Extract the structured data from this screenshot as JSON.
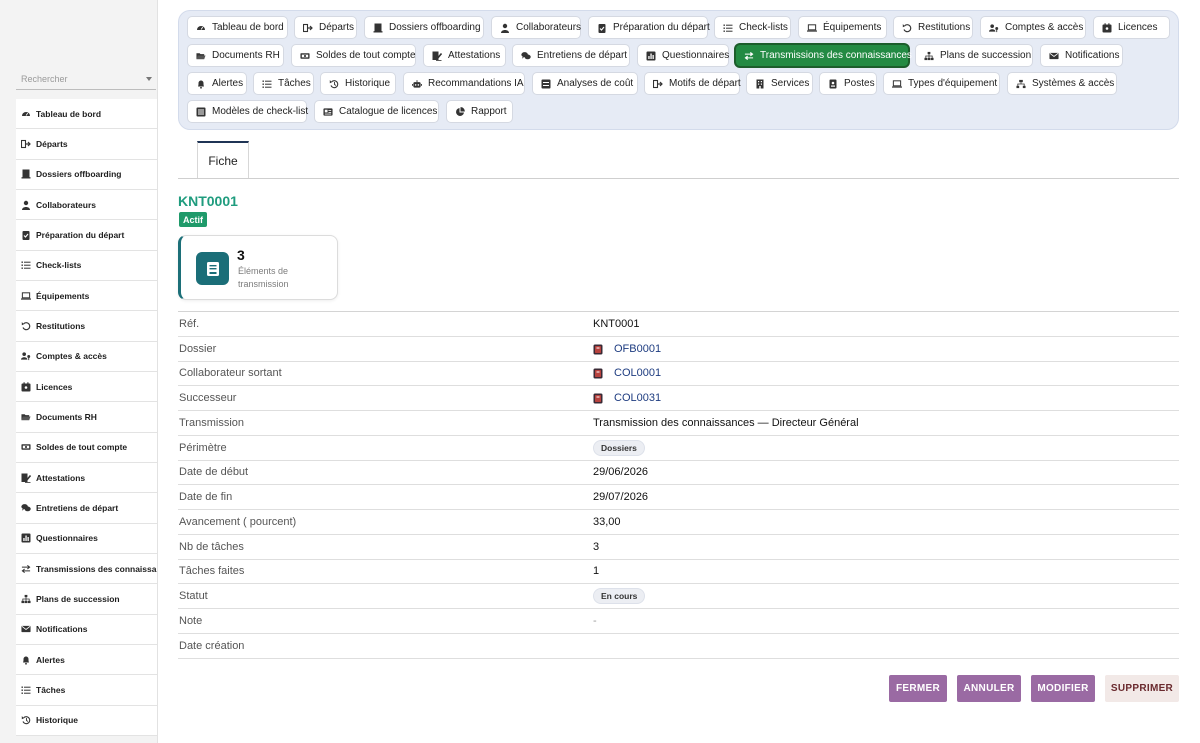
{
  "search": {
    "placeholder": "Rechercher"
  },
  "sidebar": {
    "items": [
      {
        "label": "Tableau de bord",
        "icon": "dashboard-icon"
      },
      {
        "label": "Départs",
        "icon": "exit-icon"
      },
      {
        "label": "Dossiers offboarding",
        "icon": "folder-user-icon"
      },
      {
        "label": "Collaborateurs",
        "icon": "user-icon"
      },
      {
        "label": "Préparation du départ",
        "icon": "clipboard-check-icon"
      },
      {
        "label": "Check-lists",
        "icon": "list-icon"
      },
      {
        "label": "Équipements",
        "icon": "laptop-icon"
      },
      {
        "label": "Restitutions",
        "icon": "undo-icon"
      },
      {
        "label": "Comptes & accès",
        "icon": "users-key-icon"
      },
      {
        "label": "Licences",
        "icon": "license-icon"
      },
      {
        "label": "Documents RH",
        "icon": "folder-open-icon"
      },
      {
        "label": "Soldes de tout compte",
        "icon": "money-icon"
      },
      {
        "label": "Attestations",
        "icon": "signature-icon"
      },
      {
        "label": "Entretiens de départ",
        "icon": "comments-icon"
      },
      {
        "label": "Questionnaires",
        "icon": "poll-icon"
      },
      {
        "label": "Transmissions des connaissances",
        "icon": "exchange-icon"
      },
      {
        "label": "Plans de succession",
        "icon": "sitemap-icon"
      },
      {
        "label": "Notifications",
        "icon": "envelope-icon"
      },
      {
        "label": "Alertes",
        "icon": "bell-icon"
      },
      {
        "label": "Tâches",
        "icon": "tasks-icon"
      },
      {
        "label": "Historique",
        "icon": "history-icon"
      }
    ]
  },
  "toolbar": {
    "buttons": [
      {
        "label": "Tableau de bord",
        "icon": "dashboard-icon"
      },
      {
        "label": "Départs",
        "icon": "exit-icon"
      },
      {
        "label": "Dossiers offboarding",
        "icon": "folder-user-icon"
      },
      {
        "label": "Collaborateurs",
        "icon": "user-icon"
      },
      {
        "label": "Préparation du départ",
        "icon": "clipboard-check-icon"
      },
      {
        "label": "Check-lists",
        "icon": "list-icon"
      },
      {
        "label": "Équipements",
        "icon": "laptop-icon"
      },
      {
        "label": "Restitutions",
        "icon": "undo-icon"
      },
      {
        "label": "Comptes & accès",
        "icon": "users-key-icon"
      },
      {
        "label": "Licences",
        "icon": "license-icon"
      },
      {
        "label": "Documents RH",
        "icon": "folder-open-icon"
      },
      {
        "label": "Soldes de tout compte",
        "icon": "money-icon"
      },
      {
        "label": "Attestations",
        "icon": "signature-icon"
      },
      {
        "label": "Entretiens de départ",
        "icon": "comments-icon"
      },
      {
        "label": "Questionnaires",
        "icon": "poll-icon"
      },
      {
        "label": "Transmissions des connaissances",
        "icon": "exchange-icon",
        "active": true
      },
      {
        "label": "Plans de succession",
        "icon": "sitemap-icon"
      },
      {
        "label": "Notifications",
        "icon": "envelope-icon"
      },
      {
        "label": "Alertes",
        "icon": "bell-icon"
      },
      {
        "label": "Tâches",
        "icon": "tasks-icon"
      },
      {
        "label": "Historique",
        "icon": "history-icon"
      },
      {
        "label": "Recommandations IA",
        "icon": "robot-icon"
      },
      {
        "label": "Analyses de coût",
        "icon": "money-bill-icon"
      },
      {
        "label": "Motifs de départ",
        "icon": "exit-icon"
      },
      {
        "label": "Services",
        "icon": "building-icon"
      },
      {
        "label": "Postes",
        "icon": "id-badge-icon"
      },
      {
        "label": "Types d'équipement",
        "icon": "laptop-icon"
      },
      {
        "label": "Systèmes & accès",
        "icon": "network-icon"
      },
      {
        "label": "Modèles de check-list",
        "icon": "template-icon"
      },
      {
        "label": "Catalogue de licences",
        "icon": "catalog-icon"
      },
      {
        "label": "Rapport",
        "icon": "pie-chart-icon"
      }
    ]
  },
  "tabs": [
    {
      "label": "Fiche"
    }
  ],
  "record": {
    "title": "KNT0001",
    "status_badge": "Actif",
    "kpi": {
      "value": "3",
      "label": "Éléments de transmission"
    }
  },
  "fields": [
    {
      "label": "Réf.",
      "value": "KNT0001",
      "kind": "text"
    },
    {
      "label": "Dossier",
      "value": "OFB0001",
      "kind": "link"
    },
    {
      "label": "Collaborateur sortant",
      "value": "COL0001",
      "kind": "link"
    },
    {
      "label": "Successeur",
      "value": "COL0031",
      "kind": "link"
    },
    {
      "label": "Transmission",
      "value": "Transmission des connaissances — Directeur Général",
      "kind": "text"
    },
    {
      "label": "Périmètre",
      "value": "Dossiers",
      "kind": "chip"
    },
    {
      "label": "Date de début",
      "value": "29/06/2026",
      "kind": "text"
    },
    {
      "label": "Date de fin",
      "value": "29/07/2026",
      "kind": "text"
    },
    {
      "label": "Avancement ( pourcent)",
      "value": "33,00",
      "kind": "text"
    },
    {
      "label": "Nb de tâches",
      "value": "3",
      "kind": "text"
    },
    {
      "label": "Tâches faites",
      "value": "1",
      "kind": "text"
    },
    {
      "label": "Statut",
      "value": "En cours",
      "kind": "chip"
    },
    {
      "label": "Note",
      "value": "-",
      "kind": "dash"
    },
    {
      "label": "Date création",
      "value": "",
      "kind": "text"
    }
  ],
  "actions": {
    "close": "FERMER",
    "cancel": "ANNULER",
    "edit": "MODIFIER",
    "delete": "SUPPRIMER"
  },
  "colors": {
    "accent_green": "#238a43",
    "title_teal": "#1f9c7e",
    "action_purple": "#9a6aa3",
    "link_blue": "#1e3c80",
    "kpi_teal": "#1b6e78"
  }
}
